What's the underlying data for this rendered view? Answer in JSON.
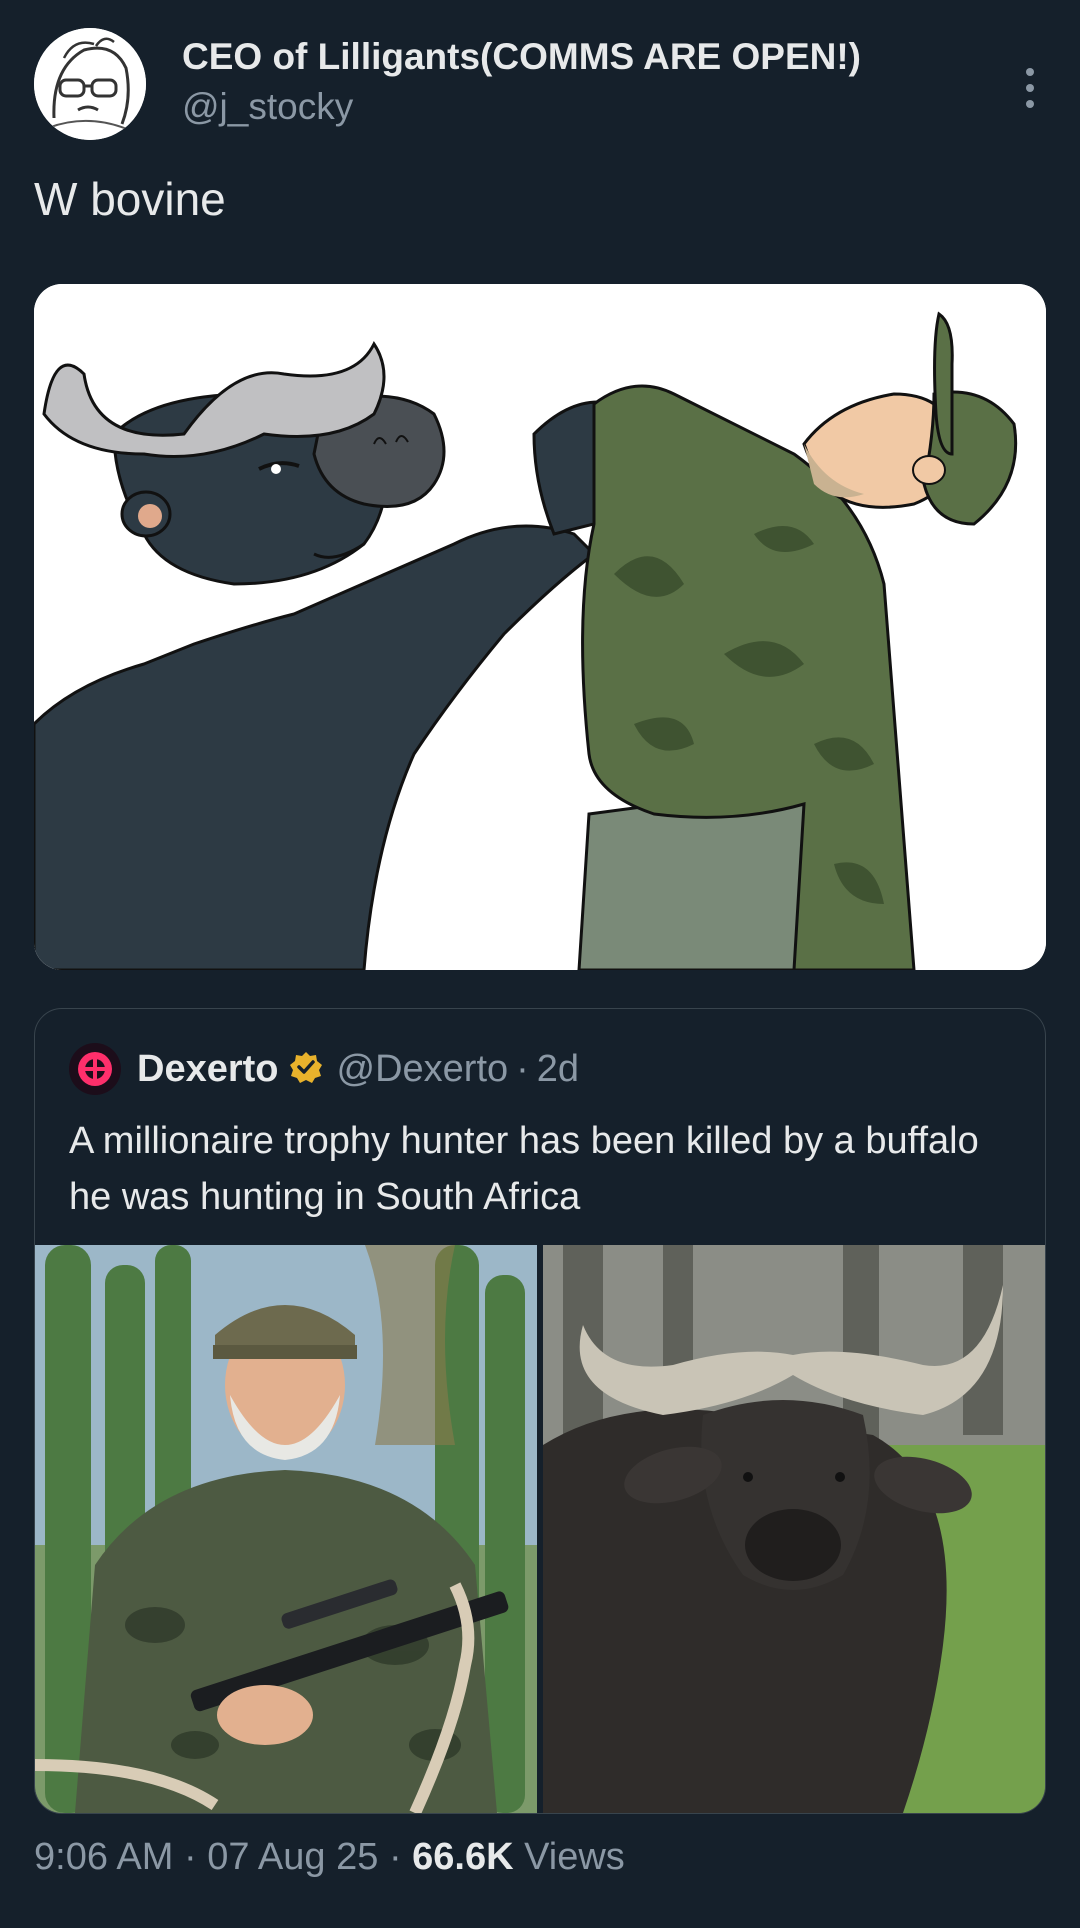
{
  "author": {
    "display_name": "CEO of Lilligants(COMMS ARE OPEN!)",
    "handle": "@j_stocky",
    "avatar_icon": "sketch-avatar"
  },
  "tweet": {
    "text": "W bovine",
    "media_alt": "cartoon buffalo grabbing hunter"
  },
  "quoted": {
    "name": "Dexerto",
    "verified": true,
    "handle": "@Dexerto",
    "separator": "·",
    "age": "2d",
    "text": "A millionaire trophy hunter has been killed by a buffalo he was hunting in South Africa"
  },
  "footer": {
    "time": "9:06 AM",
    "date": "07 Aug 25",
    "views_count": "66.6K",
    "views_label": "Views"
  },
  "colors": {
    "background": "#15202b",
    "secondary_text": "#8b98a5",
    "verified_gold": "#e8b22c"
  }
}
